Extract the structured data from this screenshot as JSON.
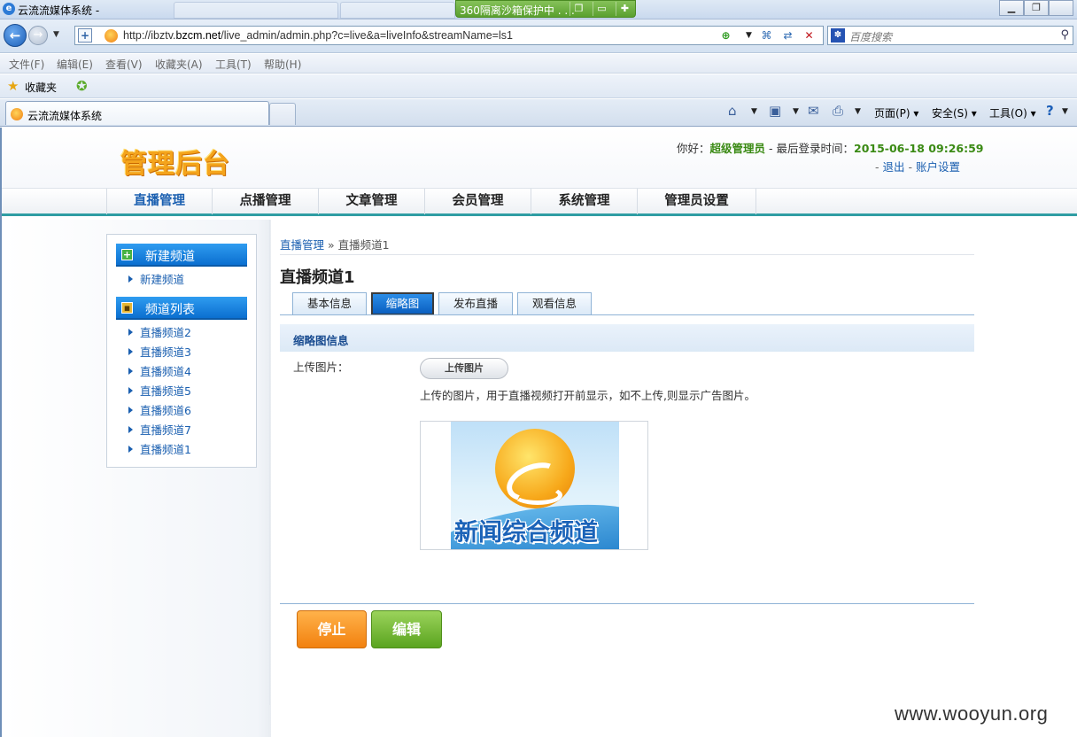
{
  "window": {
    "title": "云流流媒体系统 -",
    "sandbox_text": "360隔离沙箱保护中 . . ."
  },
  "address": {
    "url_prefix": "http://ibztv.",
    "url_domain": "bzcm.net",
    "url_path": "/live_admin/admin.php?c=live&a=liveInfo&streamName=ls1",
    "search_placeholder": "百度搜索"
  },
  "menus": [
    "文件(F)",
    "编辑(E)",
    "查看(V)",
    "收藏夹(A)",
    "工具(T)",
    "帮助(H)"
  ],
  "favorites": {
    "label": "收藏夹"
  },
  "tab": {
    "label": "云流流媒体系统"
  },
  "commands": {
    "page": "页面(P) ▾",
    "safety": "安全(S) ▾",
    "tools": "工具(O) ▾"
  },
  "header": {
    "logo": "管理后台",
    "greeting": "你好：",
    "username": "超级管理员",
    "last_login_label": " - 最后登录时间：",
    "last_login_time": "2015-06-18 09:26:59",
    "sep1": "- ",
    "logout": "退出",
    "sep2": " - ",
    "account_settings": "账户设置"
  },
  "nav": [
    "直播管理",
    "点播管理",
    "文章管理",
    "会员管理",
    "系统管理",
    "管理员设置"
  ],
  "sidebar": {
    "new_channel_head": "新建频道",
    "new_channel_link": "新建频道",
    "channel_list_head": "频道列表",
    "channels": [
      "直播频道2",
      "直播频道3",
      "直播频道4",
      "直播频道5",
      "直播频道6",
      "直播频道7",
      "直播频道1"
    ]
  },
  "breadcrumb": {
    "root": "直播管理",
    "sep": " » ",
    "current": "直播频道1"
  },
  "page_title": "直播频道1",
  "subtabs": [
    "基本信息",
    "缩略图",
    "发布直播",
    "观看信息"
  ],
  "section": {
    "title": "缩略图信息",
    "upload_label": "上传图片：",
    "upload_button": "上传图片",
    "hint": "上传的图片，用于直播视频打开前显示，如不上传,则显示广告图片。",
    "thumbnail_caption": "新闻综合频道"
  },
  "actions": {
    "stop": "停止",
    "edit": "编辑"
  },
  "watermark": "www.wooyun.org"
}
